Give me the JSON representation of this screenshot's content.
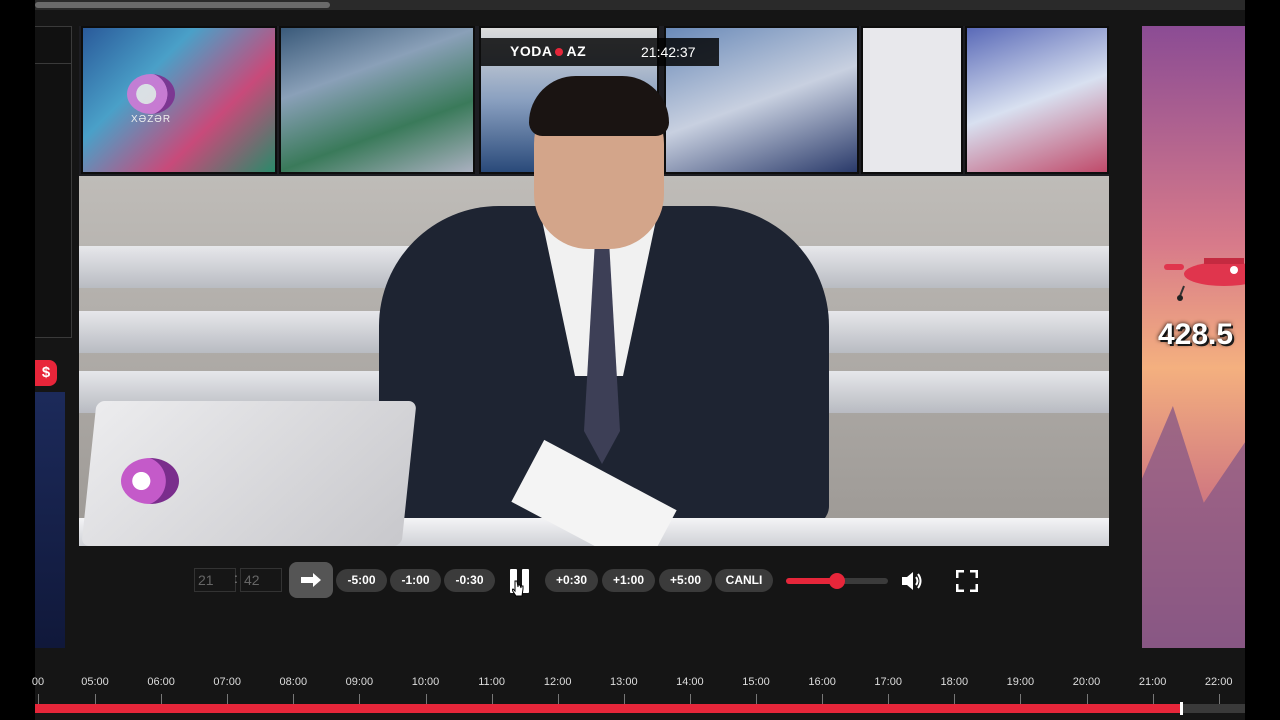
{
  "osd": {
    "brand_left": "YODA",
    "brand_right": "AZ",
    "clock": "21:42:37"
  },
  "channel_logo": {
    "text": "XƏZƏR"
  },
  "left_badge": "$",
  "controls": {
    "hour_value": "21",
    "minute_value": "42",
    "time_separator": ":",
    "go_icon": "arrow-right-icon",
    "seek_back": [
      "-5:00",
      "-1:00",
      "-0:30"
    ],
    "seek_forward": [
      "+0:30",
      "+1:00",
      "+5:00"
    ],
    "live_label": "CANLI",
    "volume_level": 0.5,
    "accent_color": "#e6263a"
  },
  "ad": {
    "value_text": "428.5"
  },
  "timeline": {
    "labels": [
      "00",
      "05:00",
      "06:00",
      "07:00",
      "08:00",
      "09:00",
      "10:00",
      "11:00",
      "12:00",
      "13:00",
      "14:00",
      "15:00",
      "16:00",
      "17:00",
      "18:00",
      "19:00",
      "20:00",
      "21:00",
      "22:00"
    ],
    "progress_fraction": 0.946
  }
}
